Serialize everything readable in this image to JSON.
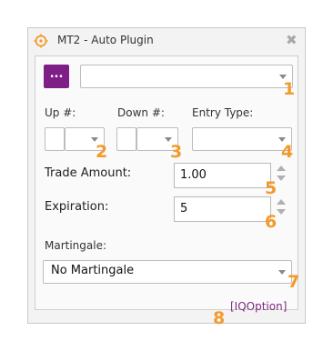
{
  "window": {
    "title": "MT2 - Auto Plugin",
    "close_glyph": "✖",
    "icon": "target-gear-icon"
  },
  "top_row": {
    "dots_label": "...",
    "select_value": ""
  },
  "labels": {
    "up": "Up #:",
    "down": "Down #:",
    "entry_type": "Entry Type:",
    "trade_amount": "Trade Amount:",
    "expiration": "Expiration:",
    "martingale": "Martingale:"
  },
  "fields": {
    "trade_amount": "1.00",
    "expiration": "5",
    "martingale": "No Martingale"
  },
  "footer": {
    "link": "[IQOption]"
  },
  "badges": [
    "1",
    "2",
    "3",
    "4",
    "5",
    "6",
    "7",
    "8"
  ],
  "colors": {
    "accent_purple": "#7f1e86",
    "badge_orange": "#f39a2c"
  }
}
